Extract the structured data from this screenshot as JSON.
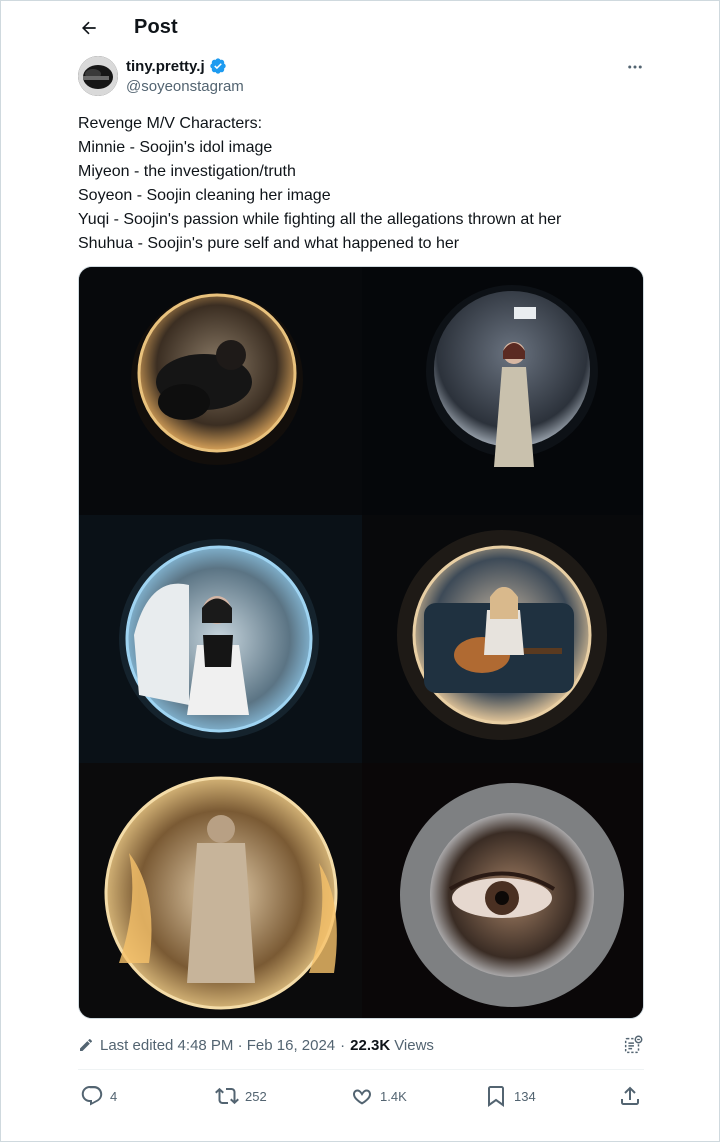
{
  "header": {
    "title": "Post",
    "back_icon": "arrow-left-icon"
  },
  "author": {
    "display_name": "tiny.pretty.j",
    "handle": "@soyeonstagram",
    "verified": true,
    "verified_color": "#1d9bf0"
  },
  "tweet": {
    "lines": [
      "Revenge M/V Characters:",
      "Minnie - Soojin's idol image",
      "Miyeon - the investigation/truth",
      "Soyeon - Soojin cleaning her image",
      "Yuqi - Soojin's passion while fighting all the allegations thrown at her",
      "Shuhua - Soojin's pure self and what happened to her"
    ]
  },
  "media": {
    "images": [
      {
        "icon": "peephole-photo-woman-lying",
        "tint": "#e7c07a"
      },
      {
        "icon": "peephole-photo-woman-trench-coat",
        "tint": "#7d8796"
      },
      {
        "icon": "peephole-photo-woman-sitting-floor",
        "tint": "#7fb2cf"
      },
      {
        "icon": "peephole-photo-woman-guitar",
        "tint": "#d9b58a"
      },
      {
        "icon": "peephole-photo-woman-fire",
        "tint": "#e8b56a"
      },
      {
        "icon": "peephole-photo-eye-closeup",
        "tint": "#b79a7a"
      }
    ]
  },
  "meta": {
    "edited": "Last edited 4:48 PM · Feb 16, 2024",
    "views_count": "22.3K",
    "views_label": "Views"
  },
  "actions": {
    "replies": "4",
    "reposts": "252",
    "likes": "1.4K",
    "bookmarks": "134"
  },
  "colors": {
    "text": "#0f1419",
    "secondary": "#536471",
    "border": "#cfd9de",
    "verified": "#1d9bf0"
  }
}
